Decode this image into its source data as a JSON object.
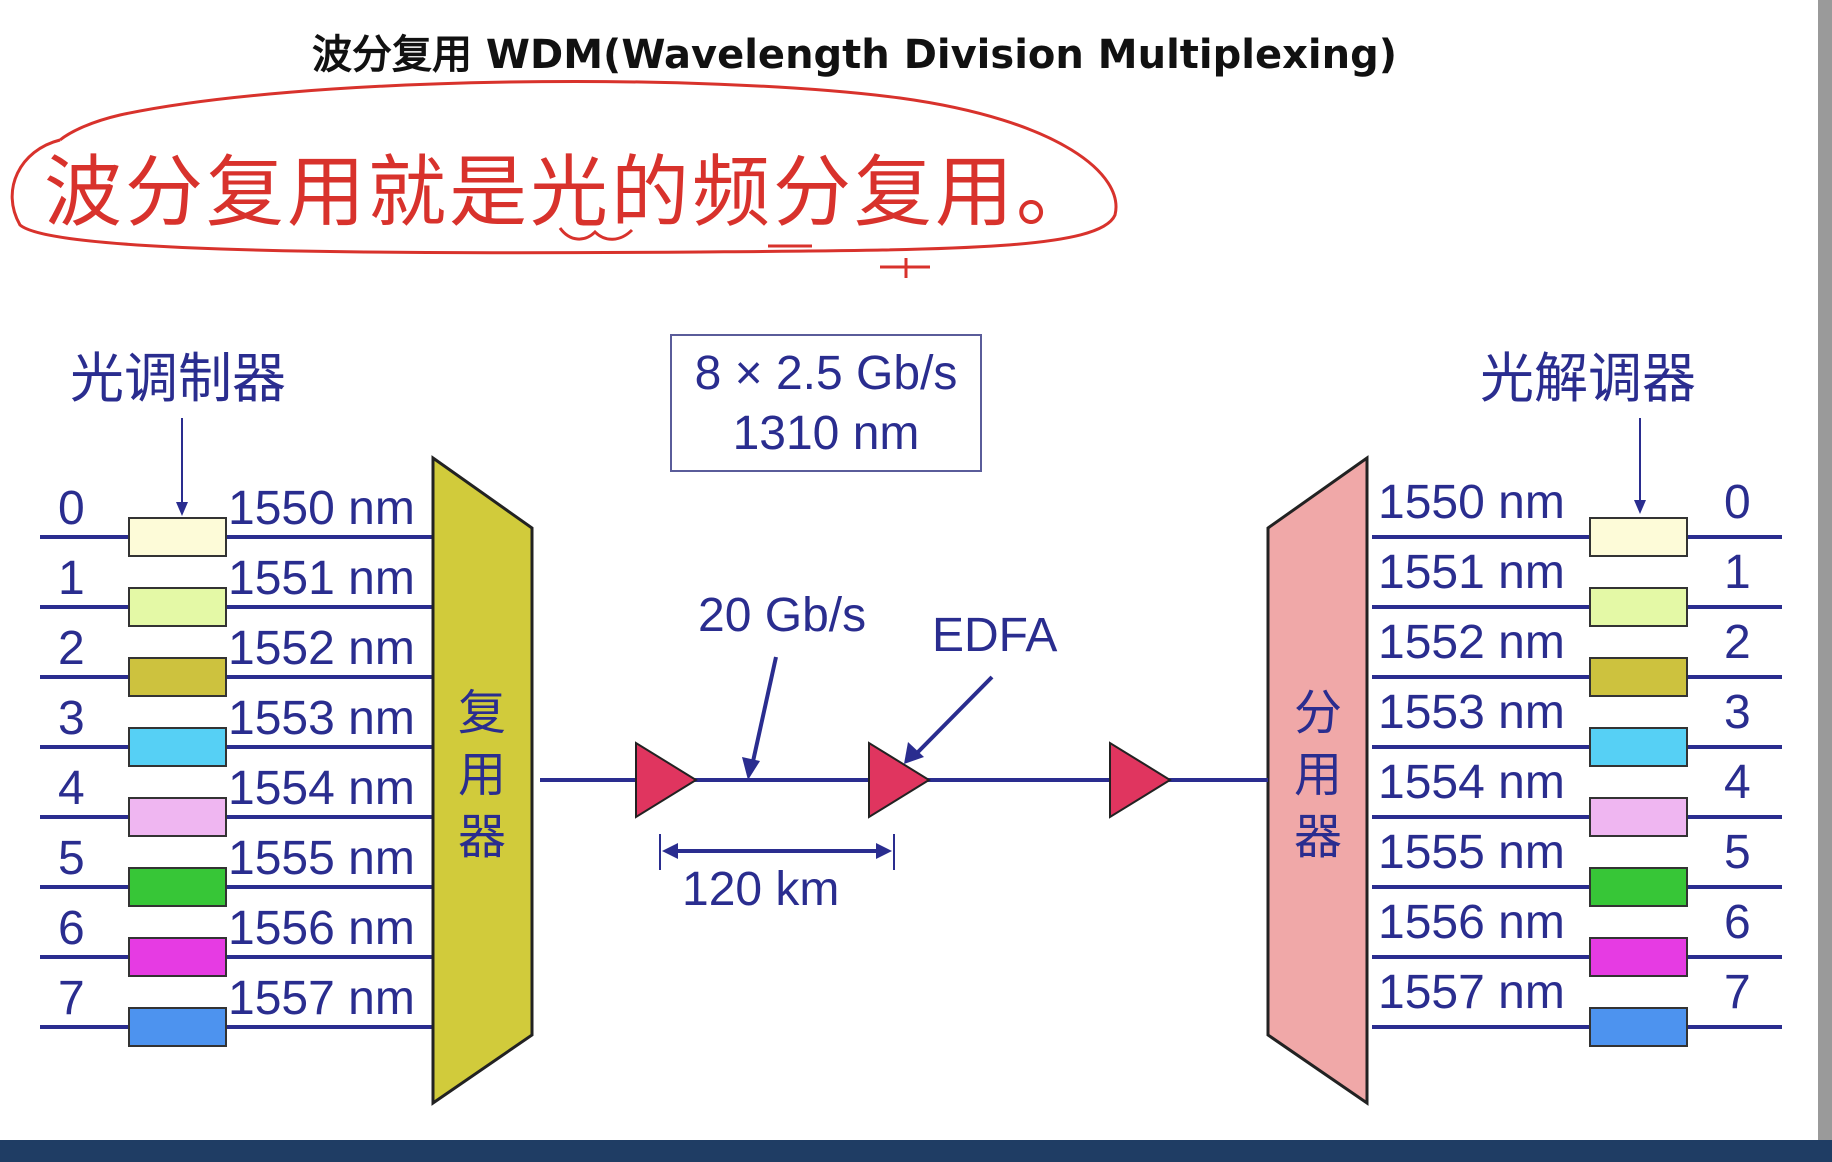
{
  "title": "波分复用 WDM(Wavelength Division Multiplexing)",
  "handwritten_note": "波分复用就是光的频分复用。",
  "left_heading": "光调制器",
  "right_heading": "光解调器",
  "mux_label": [
    "复",
    "用",
    "器"
  ],
  "demux_label": [
    "分",
    "用",
    "器"
  ],
  "input_box": {
    "line1": "8 × 2.5 Gb/s",
    "line2": "1310 nm"
  },
  "bitrate_label": "20 Gb/s",
  "edfa_label": "EDFA",
  "distance_label": "120 km",
  "channels": [
    {
      "index": "0",
      "wavelength": "1550 nm",
      "color": "#fdfbd8"
    },
    {
      "index": "1",
      "wavelength": "1551 nm",
      "color": "#e4f9a6"
    },
    {
      "index": "2",
      "wavelength": "1552 nm",
      "color": "#cdc23e"
    },
    {
      "index": "3",
      "wavelength": "1553 nm",
      "color": "#56d0f5"
    },
    {
      "index": "4",
      "wavelength": "1554 nm",
      "color": "#efb6f1"
    },
    {
      "index": "5",
      "wavelength": "1555 nm",
      "color": "#37c637"
    },
    {
      "index": "6",
      "wavelength": "1556 nm",
      "color": "#e63be3"
    },
    {
      "index": "7",
      "wavelength": "1557 nm",
      "color": "#4d93ef"
    }
  ],
  "colors": {
    "ink": "#2a2d8f",
    "mux": "#d1cb3b",
    "demux": "#f0a8a8",
    "amplifier": "#e0355f",
    "annotation": "#d8322c"
  }
}
